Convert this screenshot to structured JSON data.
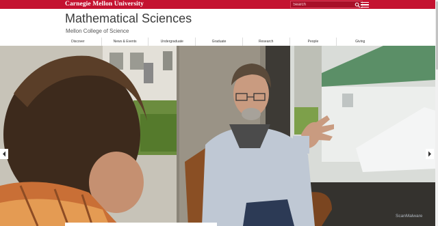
{
  "header": {
    "brand": "Carnegie Mellon University",
    "search_placeholder": "Search",
    "site_title": "Mathematical Sciences",
    "site_subtitle": "Mellon College of Science"
  },
  "nav": {
    "items": [
      {
        "label": "Discover"
      },
      {
        "label": "News & Events"
      },
      {
        "label": "Undergraduate"
      },
      {
        "label": "Graduate"
      },
      {
        "label": "Research"
      },
      {
        "label": "People"
      },
      {
        "label": "Giving"
      }
    ]
  },
  "hero": {
    "watermark": "ScanMalware"
  },
  "colors": {
    "brand_red": "#c41230",
    "text_dark": "#3a3a3a"
  },
  "icons": [
    "search-icon",
    "menu-icon",
    "chevron-left-icon",
    "chevron-right-icon"
  ]
}
